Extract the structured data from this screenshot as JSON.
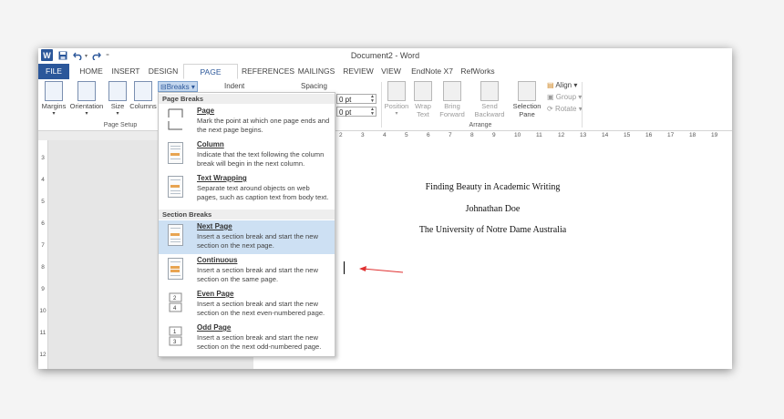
{
  "title_bar": {
    "app_logo": "W",
    "document_title": "Document2 - Word",
    "icons": [
      "word-logo-icon",
      "save-icon",
      "undo-icon",
      "redo-icon",
      "customize-icon"
    ]
  },
  "tabs": [
    {
      "label": "FILE"
    },
    {
      "label": "HOME"
    },
    {
      "label": "INSERT"
    },
    {
      "label": "DESIGN"
    },
    {
      "label": "PAGE LAYOUT"
    },
    {
      "label": "REFERENCES"
    },
    {
      "label": "MAILINGS"
    },
    {
      "label": "REVIEW"
    },
    {
      "label": "VIEW"
    },
    {
      "label": "EndNote X7"
    },
    {
      "label": "RefWorks"
    }
  ],
  "ribbon": {
    "page_setup": {
      "margins": "Margins",
      "orientation": "Orientation",
      "size": "Size",
      "columns": "Columns",
      "group_label": "Page Setup"
    },
    "breaks_button": "Breaks",
    "indent_label": "Indent",
    "spacing_label": "Spacing",
    "spacing_before": "0 pt",
    "spacing_after": "0 pt",
    "arrange": {
      "position": "Position",
      "wrap_text_1": "Wrap",
      "wrap_text_2": "Text",
      "bring_forward_1": "Bring",
      "bring_forward_2": "Forward",
      "send_backward_1": "Send",
      "send_backward_2": "Backward",
      "selection_pane_1": "Selection",
      "selection_pane_2": "Pane",
      "align": "Align",
      "group": "Group",
      "rotate": "Rotate",
      "group_label": "Arrange"
    }
  },
  "breaks_menu": {
    "page_breaks_header": "Page Breaks",
    "section_breaks_header": "Section Breaks",
    "items": [
      {
        "title": "Page",
        "desc": "Mark the point at which one page ends and the next page begins."
      },
      {
        "title": "Column",
        "desc": "Indicate that the text following the column break will begin in the next column."
      },
      {
        "title": "Text Wrapping",
        "desc": "Separate text around objects on web pages, such as caption text from body text."
      },
      {
        "title": "Next Page",
        "desc": "Insert a section break and start the new section on the next page."
      },
      {
        "title": "Continuous",
        "desc": "Insert a section break and start the new section on the same page."
      },
      {
        "title": "Even Page",
        "desc": "Insert a section break and start the new section on the next even-numbered page."
      },
      {
        "title": "Odd Page",
        "desc": "Insert a section break and start the new section on the next odd-numbered page."
      }
    ]
  },
  "rulers": {
    "horizontal": [
      "2",
      "3",
      "4",
      "5",
      "6",
      "7",
      "8",
      "9",
      "10",
      "11",
      "12",
      "13",
      "14",
      "15",
      "16",
      "17",
      "18",
      "19"
    ],
    "vertical": [
      "3",
      "4",
      "5",
      "6",
      "7",
      "8",
      "9",
      "10",
      "11",
      "12"
    ]
  },
  "document": {
    "line1": "Finding Beauty in Academic Writing",
    "line2": "Johnathan Doe",
    "line3": "The University of Notre Dame Australia"
  },
  "colors": {
    "accent": "#2b579a",
    "highlight": "#cde0f3",
    "annotation_arrow": "#e03030"
  }
}
